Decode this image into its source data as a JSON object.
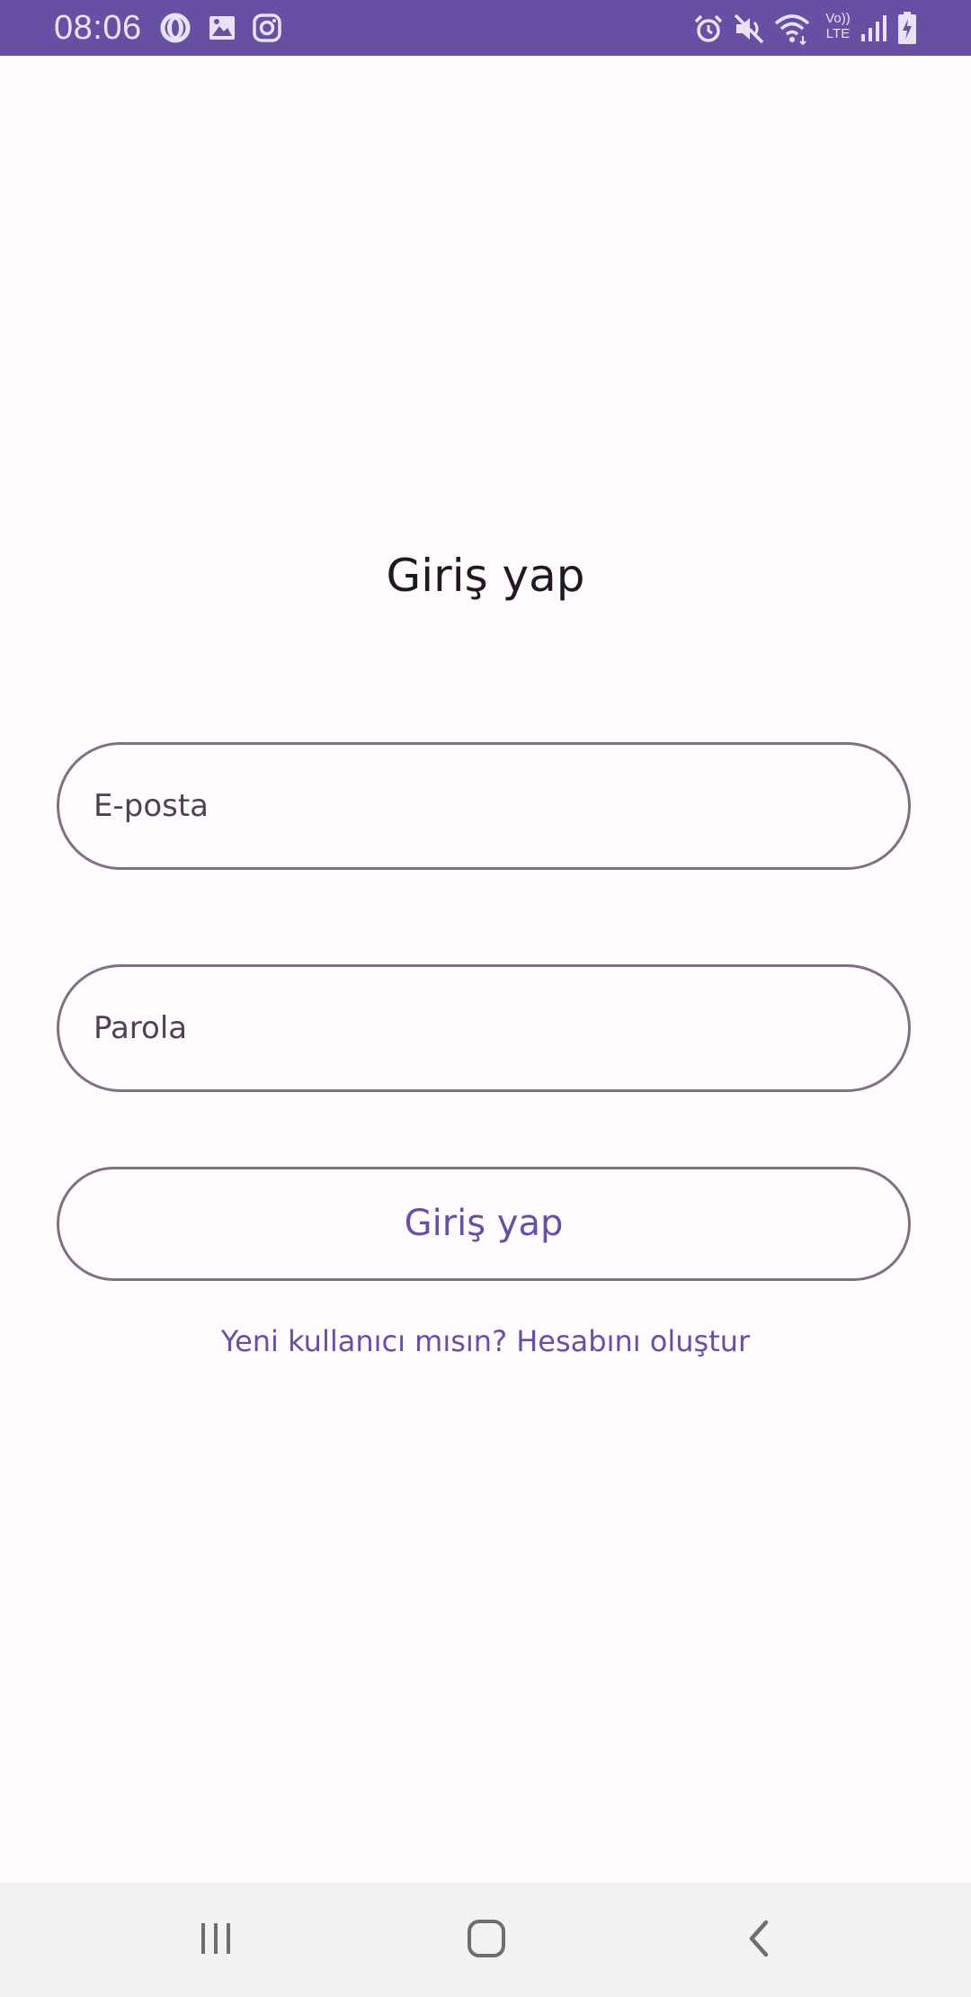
{
  "status_bar": {
    "time": "08:06",
    "left_icons": [
      "opera-icon",
      "gallery-icon",
      "instagram-icon"
    ],
    "right_icons": [
      "alarm-icon",
      "mute-icon",
      "wifi-icon",
      "volte-icon",
      "signal-icon",
      "battery-charging-icon"
    ],
    "volte_label_top": "Vo))",
    "volte_label_bottom": "LTE",
    "background_color": "#6750a4"
  },
  "login": {
    "title": "Giriş yap",
    "email_placeholder": "E-posta",
    "password_placeholder": "Parola",
    "submit_label": "Giriş yap",
    "register_link": "Yeni kullanıcı mısın? Hesabını oluştur"
  },
  "nav_bar": {
    "buttons": [
      "recent-apps-icon",
      "home-icon",
      "back-icon"
    ]
  },
  "colors": {
    "accent": "#6750a4",
    "outline": "#79747e",
    "background": "#fffbfe",
    "text": "#1c1b1f"
  }
}
